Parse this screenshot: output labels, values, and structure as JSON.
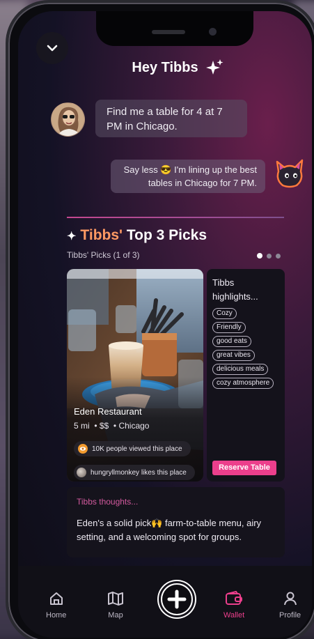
{
  "header": {
    "greeting": "Hey Tibbs"
  },
  "chat": {
    "user_message": "Find me a table for 4 at 7 PM in Chicago.",
    "bot_message": "Say less 😎 I'm lining up the best tables in Chicago for 7 PM."
  },
  "picks": {
    "title_brand": "Tibbs'",
    "title_rest": " Top 3 Picks",
    "subtitle": "Tibbs' Picks (1 of 3)",
    "page_count": 3,
    "current_page": 1
  },
  "restaurant": {
    "name": "Eden Restaurant",
    "distance": "5 mi",
    "price": "$$",
    "city": "Chicago",
    "views_text": "10K people viewed this place",
    "likes_text": "hungryllmonkey likes this place"
  },
  "highlights": {
    "title": "Tibbs highlights...",
    "tags": [
      "Cozy",
      "Friendly",
      "good eats",
      "great vibes",
      "delicious meals",
      "cozy atmosphere"
    ],
    "reserve_label": "Reserve Table"
  },
  "thoughts": {
    "title": "Tibbs thoughts...",
    "text": "Eden's a solid pick🙌 farm-to-table menu, airy setting, and a welcoming spot for groups."
  },
  "tabbar": {
    "home": "Home",
    "map": "Map",
    "wallet": "Wallet",
    "profile": "Profile",
    "active": "Wallet"
  },
  "colors": {
    "accent_pink": "#ec3f8c",
    "brand_orange": "#ff9a63"
  }
}
